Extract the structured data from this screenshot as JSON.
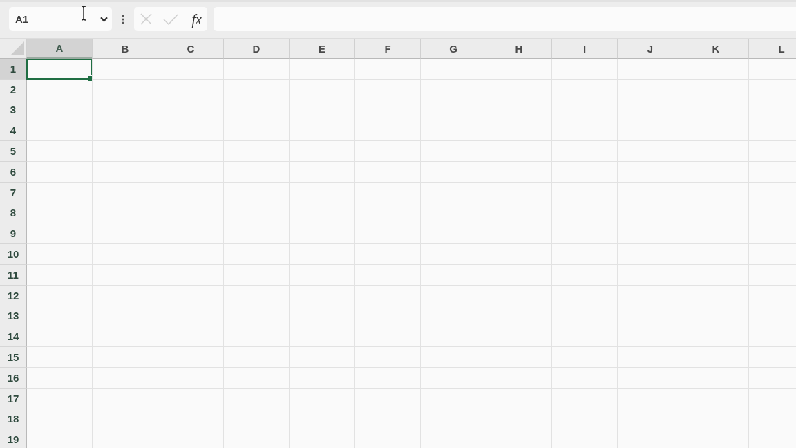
{
  "name_box": {
    "value": "A1"
  },
  "formula_bar": {
    "cancel": {
      "disabled": true
    },
    "enter": {
      "disabled": true
    },
    "function_label": "fx"
  },
  "grid": {
    "columns": [
      {
        "label": "A",
        "selected": true
      },
      {
        "label": "B",
        "selected": false
      },
      {
        "label": "C",
        "selected": false
      },
      {
        "label": "D",
        "selected": false
      },
      {
        "label": "E",
        "selected": false
      },
      {
        "label": "F",
        "selected": false
      },
      {
        "label": "G",
        "selected": false
      },
      {
        "label": "H",
        "selected": false
      },
      {
        "label": "I",
        "selected": false
      },
      {
        "label": "J",
        "selected": false
      },
      {
        "label": "K",
        "selected": false
      },
      {
        "label": "L",
        "selected": false
      }
    ],
    "rows": [
      {
        "label": "1",
        "selected": true
      },
      {
        "label": "2",
        "selected": false
      },
      {
        "label": "3",
        "selected": false
      },
      {
        "label": "4",
        "selected": false
      },
      {
        "label": "5",
        "selected": false
      },
      {
        "label": "6",
        "selected": false
      },
      {
        "label": "7",
        "selected": false
      },
      {
        "label": "8",
        "selected": false
      },
      {
        "label": "9",
        "selected": false
      },
      {
        "label": "10",
        "selected": false
      },
      {
        "label": "11",
        "selected": false
      },
      {
        "label": "12",
        "selected": false
      },
      {
        "label": "13",
        "selected": false
      },
      {
        "label": "14",
        "selected": false
      },
      {
        "label": "15",
        "selected": false
      },
      {
        "label": "16",
        "selected": false
      },
      {
        "label": "17",
        "selected": false
      },
      {
        "label": "18",
        "selected": false
      },
      {
        "label": "19",
        "selected": false
      }
    ]
  }
}
